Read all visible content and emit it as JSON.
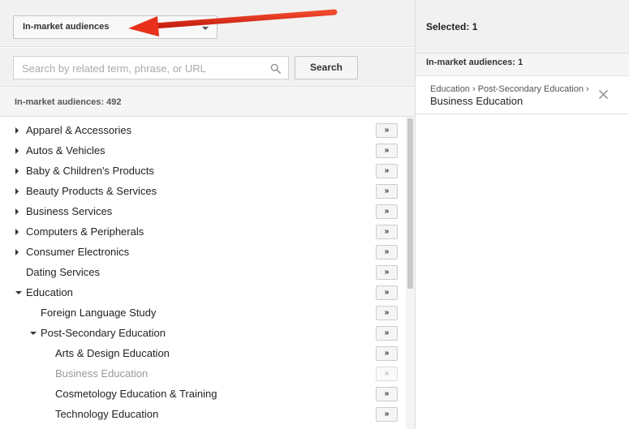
{
  "picker": {
    "dropdown_label": "In-market audiences",
    "search_placeholder": "Search by related term, phrase, or URL",
    "search_button": "Search",
    "count_label": "In-market audiences: 492",
    "add_label": "»"
  },
  "categories": [
    {
      "label": "Apparel & Accessories",
      "expander": "collapsed",
      "depth": 0
    },
    {
      "label": "Autos & Vehicles",
      "expander": "collapsed",
      "depth": 0
    },
    {
      "label": "Baby & Children's Products",
      "expander": "collapsed",
      "depth": 0
    },
    {
      "label": "Beauty Products & Services",
      "expander": "collapsed",
      "depth": 0
    },
    {
      "label": "Business Services",
      "expander": "collapsed",
      "depth": 0
    },
    {
      "label": "Computers & Peripherals",
      "expander": "collapsed",
      "depth": 0
    },
    {
      "label": "Consumer Electronics",
      "expander": "collapsed",
      "depth": 0
    },
    {
      "label": "Dating Services",
      "expander": "none",
      "depth": 0
    },
    {
      "label": "Education",
      "expander": "expanded",
      "depth": 0
    },
    {
      "label": "Foreign Language Study",
      "expander": "none",
      "depth": 1
    },
    {
      "label": "Post-Secondary Education",
      "expander": "expanded",
      "depth": 1
    },
    {
      "label": "Arts & Design Education",
      "expander": "none",
      "depth": 2
    },
    {
      "label": "Business Education",
      "expander": "none",
      "depth": 2,
      "disabled": true
    },
    {
      "label": "Cosmetology Education & Training",
      "expander": "none",
      "depth": 2
    },
    {
      "label": "Technology Education",
      "expander": "none",
      "depth": 2
    }
  ],
  "selected": {
    "title": "Selected: 1",
    "group_label": "In-market audiences: 1",
    "items": [
      {
        "path": "Education › Post-Secondary Education ›",
        "name": "Business Education"
      }
    ]
  },
  "colors": {
    "annotation_arrow": "#e8301c"
  }
}
